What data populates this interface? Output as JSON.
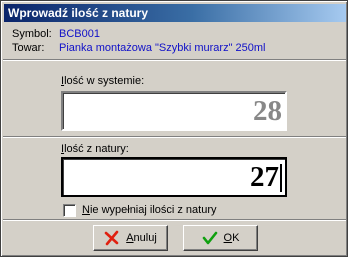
{
  "window": {
    "title": "Wprowadź ilość z natury"
  },
  "info": {
    "symbol_label": "Symbol:",
    "symbol_value": "BCB001",
    "towar_label": "Towar:",
    "towar_value": "Pianka montażowa \"Szybki murarz\" 250ml"
  },
  "system_qty": {
    "label_first": "I",
    "label_rest": "lość w systemie:",
    "value": "28"
  },
  "natural_qty": {
    "label_first": "I",
    "label_rest": "lość z natury:",
    "value": "27"
  },
  "checkbox": {
    "label_first": "N",
    "label_rest": "ie wypełniaj ilości z natury",
    "checked": false
  },
  "buttons": {
    "cancel_first": "A",
    "cancel_rest": "nuluj",
    "ok_first": "O",
    "ok_rest": "K"
  },
  "colors": {
    "title_gradient_start": "#0a246a",
    "title_gradient_end": "#a6caf0",
    "info_value": "#1010c8",
    "dialog_bg": "#d4d0c8",
    "cancel_icon": "#e02010",
    "ok_icon": "#10a010"
  },
  "icons": {
    "cancel": "red-x-icon",
    "ok": "green-checkmark-icon"
  }
}
